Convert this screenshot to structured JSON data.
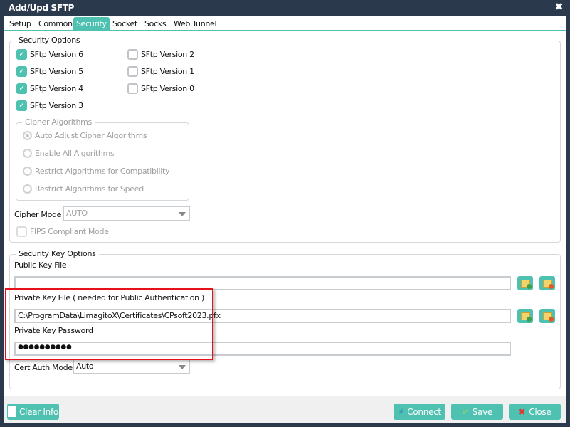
{
  "window": {
    "title": "Add/Upd SFTP",
    "close_icon": "close-icon"
  },
  "tabs": [
    {
      "label": "Setup"
    },
    {
      "label": "Common"
    },
    {
      "label": "Security",
      "active": true
    },
    {
      "label": "Socket"
    },
    {
      "label": "Socks"
    },
    {
      "label": "Web Tunnel"
    }
  ],
  "security_options": {
    "title": "Security Options",
    "versions": [
      {
        "label": "SFtp Version 6",
        "checked": true
      },
      {
        "label": "SFtp Version 5",
        "checked": true
      },
      {
        "label": "SFtp Version 4",
        "checked": true
      },
      {
        "label": "SFtp Version 3",
        "checked": true
      },
      {
        "label": "SFtp Version 2",
        "checked": false
      },
      {
        "label": "SFtp Version 1",
        "checked": false
      },
      {
        "label": "SFtp Version 0",
        "checked": false
      }
    ],
    "cipher": {
      "title": "Cipher Algorithms",
      "options": [
        "Auto Adjust Cipher Algorithms",
        "Enable All Algorithms",
        "Restrict Algorithms for Compatibility",
        "Restrict Algorithms for Speed"
      ],
      "selected": "Auto Adjust Cipher Algorithms"
    },
    "cipher_mode": {
      "label": "Cipher Mode",
      "value": "AUTO"
    },
    "fips": {
      "label": "FIPS Compliant Mode",
      "checked": false
    }
  },
  "key_options": {
    "title": "Security Key Options",
    "public_key": {
      "label": "Public Key File",
      "value": ""
    },
    "private_key": {
      "label": "Private Key File ( needed for Public Authentication )",
      "value": "C:\\ProgramData\\LimagitoX\\Certificates\\CPsoft2023.pfx"
    },
    "password": {
      "label": "Private Key Password",
      "value": "●●●●●●●●●●"
    },
    "cert_auth": {
      "label": "Cert Auth Mode",
      "value": "Auto"
    }
  },
  "buttons": {
    "clear": "Clear Info",
    "connect": "Connect",
    "save": "Save",
    "close": "Close"
  },
  "colors": {
    "accent": "#4fc1b0",
    "titlebar": "#2b394c",
    "highlight": "#e8101a"
  }
}
